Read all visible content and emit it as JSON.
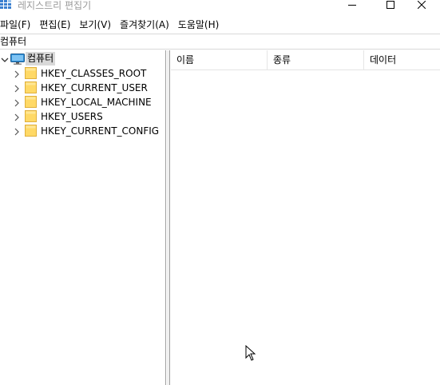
{
  "window": {
    "title": "레지스트리 편집기",
    "icon": "registry-editor-icon",
    "controls": [
      "minimize-icon",
      "maximize-icon",
      "close-icon"
    ]
  },
  "menu": {
    "items": [
      {
        "label": "파일(F)"
      },
      {
        "label": "편집(E)"
      },
      {
        "label": "보기(V)"
      },
      {
        "label": "즐겨찾기(A)"
      },
      {
        "label": "도움말(H)"
      }
    ]
  },
  "address": {
    "path": "컴퓨터"
  },
  "tree": {
    "root": {
      "label": "컴퓨터",
      "icon": "computer-icon",
      "expanded": true,
      "selected": true
    },
    "children": [
      {
        "label": "HKEY_CLASSES_ROOT"
      },
      {
        "label": "HKEY_CURRENT_USER"
      },
      {
        "label": "HKEY_LOCAL_MACHINE"
      },
      {
        "label": "HKEY_USERS"
      },
      {
        "label": "HKEY_CURRENT_CONFIG"
      }
    ]
  },
  "list": {
    "columns": [
      {
        "label": "이름"
      },
      {
        "label": "종류"
      },
      {
        "label": "데이터"
      }
    ],
    "rows": []
  },
  "colors": {
    "selection": "#d9d9d9",
    "folder": "#ffd966",
    "folder_edge": "#e0b03c",
    "monitor": "#2e8fd6",
    "title_text": "#9a9a9a"
  }
}
